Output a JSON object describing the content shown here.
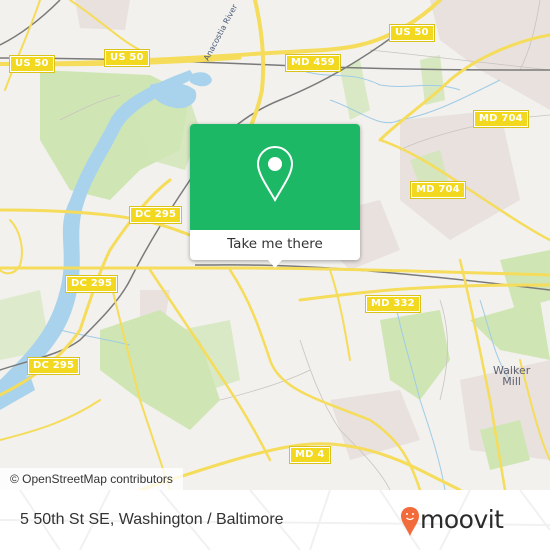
{
  "map": {
    "colors": {
      "background": "#f2f1ed",
      "park": "#cfe6b4",
      "water": "#a9d3ec",
      "road": "#f5dc5a",
      "rail": "#7a7a7a",
      "urban": "#e8e1de"
    },
    "road_labels": [
      {
        "id": "us50-west",
        "text": "US 50"
      },
      {
        "id": "us50-center",
        "text": "US 50"
      },
      {
        "id": "us50-east",
        "text": "US 50"
      },
      {
        "id": "md459",
        "text": "MD 459"
      },
      {
        "id": "md704-north",
        "text": "MD 704"
      },
      {
        "id": "md704-south",
        "text": "MD 704"
      },
      {
        "id": "dc295-north",
        "text": "DC 295"
      },
      {
        "id": "dc295-mid",
        "text": "DC 295"
      },
      {
        "id": "dc295-south",
        "text": "DC 295"
      },
      {
        "id": "md332",
        "text": "MD 332"
      },
      {
        "id": "md4",
        "text": "MD 4"
      }
    ],
    "place_labels": [
      {
        "id": "walker-mill",
        "line1": "Walker",
        "line2": "Mill"
      }
    ],
    "water_labels": [
      {
        "id": "anacostia",
        "text": "Anacostia River"
      }
    ],
    "attribution": "© OpenStreetMap contributors"
  },
  "popup": {
    "icon": "map-pin-icon",
    "button_label": "Take me there",
    "color": "#1db866"
  },
  "footer": {
    "address": "5 50th St SE, Washington / Baltimore",
    "brand": "moovit",
    "brand_color": "#f26b3a"
  }
}
